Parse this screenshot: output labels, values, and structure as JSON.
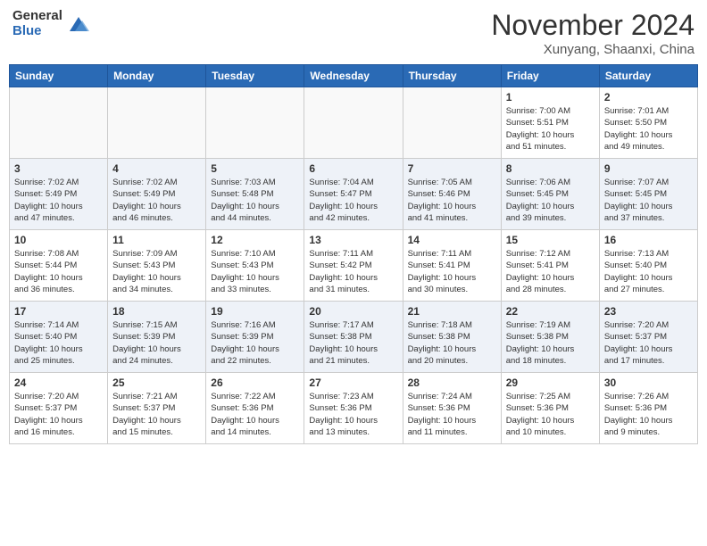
{
  "header": {
    "logo_general": "General",
    "logo_blue": "Blue",
    "month_title": "November 2024",
    "location": "Xunyang, Shaanxi, China"
  },
  "days_of_week": [
    "Sunday",
    "Monday",
    "Tuesday",
    "Wednesday",
    "Thursday",
    "Friday",
    "Saturday"
  ],
  "weeks": [
    [
      {
        "day": "",
        "info": ""
      },
      {
        "day": "",
        "info": ""
      },
      {
        "day": "",
        "info": ""
      },
      {
        "day": "",
        "info": ""
      },
      {
        "day": "",
        "info": ""
      },
      {
        "day": "1",
        "info": "Sunrise: 7:00 AM\nSunset: 5:51 PM\nDaylight: 10 hours\nand 51 minutes."
      },
      {
        "day": "2",
        "info": "Sunrise: 7:01 AM\nSunset: 5:50 PM\nDaylight: 10 hours\nand 49 minutes."
      }
    ],
    [
      {
        "day": "3",
        "info": "Sunrise: 7:02 AM\nSunset: 5:49 PM\nDaylight: 10 hours\nand 47 minutes."
      },
      {
        "day": "4",
        "info": "Sunrise: 7:02 AM\nSunset: 5:49 PM\nDaylight: 10 hours\nand 46 minutes."
      },
      {
        "day": "5",
        "info": "Sunrise: 7:03 AM\nSunset: 5:48 PM\nDaylight: 10 hours\nand 44 minutes."
      },
      {
        "day": "6",
        "info": "Sunrise: 7:04 AM\nSunset: 5:47 PM\nDaylight: 10 hours\nand 42 minutes."
      },
      {
        "day": "7",
        "info": "Sunrise: 7:05 AM\nSunset: 5:46 PM\nDaylight: 10 hours\nand 41 minutes."
      },
      {
        "day": "8",
        "info": "Sunrise: 7:06 AM\nSunset: 5:45 PM\nDaylight: 10 hours\nand 39 minutes."
      },
      {
        "day": "9",
        "info": "Sunrise: 7:07 AM\nSunset: 5:45 PM\nDaylight: 10 hours\nand 37 minutes."
      }
    ],
    [
      {
        "day": "10",
        "info": "Sunrise: 7:08 AM\nSunset: 5:44 PM\nDaylight: 10 hours\nand 36 minutes."
      },
      {
        "day": "11",
        "info": "Sunrise: 7:09 AM\nSunset: 5:43 PM\nDaylight: 10 hours\nand 34 minutes."
      },
      {
        "day": "12",
        "info": "Sunrise: 7:10 AM\nSunset: 5:43 PM\nDaylight: 10 hours\nand 33 minutes."
      },
      {
        "day": "13",
        "info": "Sunrise: 7:11 AM\nSunset: 5:42 PM\nDaylight: 10 hours\nand 31 minutes."
      },
      {
        "day": "14",
        "info": "Sunrise: 7:11 AM\nSunset: 5:41 PM\nDaylight: 10 hours\nand 30 minutes."
      },
      {
        "day": "15",
        "info": "Sunrise: 7:12 AM\nSunset: 5:41 PM\nDaylight: 10 hours\nand 28 minutes."
      },
      {
        "day": "16",
        "info": "Sunrise: 7:13 AM\nSunset: 5:40 PM\nDaylight: 10 hours\nand 27 minutes."
      }
    ],
    [
      {
        "day": "17",
        "info": "Sunrise: 7:14 AM\nSunset: 5:40 PM\nDaylight: 10 hours\nand 25 minutes."
      },
      {
        "day": "18",
        "info": "Sunrise: 7:15 AM\nSunset: 5:39 PM\nDaylight: 10 hours\nand 24 minutes."
      },
      {
        "day": "19",
        "info": "Sunrise: 7:16 AM\nSunset: 5:39 PM\nDaylight: 10 hours\nand 22 minutes."
      },
      {
        "day": "20",
        "info": "Sunrise: 7:17 AM\nSunset: 5:38 PM\nDaylight: 10 hours\nand 21 minutes."
      },
      {
        "day": "21",
        "info": "Sunrise: 7:18 AM\nSunset: 5:38 PM\nDaylight: 10 hours\nand 20 minutes."
      },
      {
        "day": "22",
        "info": "Sunrise: 7:19 AM\nSunset: 5:38 PM\nDaylight: 10 hours\nand 18 minutes."
      },
      {
        "day": "23",
        "info": "Sunrise: 7:20 AM\nSunset: 5:37 PM\nDaylight: 10 hours\nand 17 minutes."
      }
    ],
    [
      {
        "day": "24",
        "info": "Sunrise: 7:20 AM\nSunset: 5:37 PM\nDaylight: 10 hours\nand 16 minutes."
      },
      {
        "day": "25",
        "info": "Sunrise: 7:21 AM\nSunset: 5:37 PM\nDaylight: 10 hours\nand 15 minutes."
      },
      {
        "day": "26",
        "info": "Sunrise: 7:22 AM\nSunset: 5:36 PM\nDaylight: 10 hours\nand 14 minutes."
      },
      {
        "day": "27",
        "info": "Sunrise: 7:23 AM\nSunset: 5:36 PM\nDaylight: 10 hours\nand 13 minutes."
      },
      {
        "day": "28",
        "info": "Sunrise: 7:24 AM\nSunset: 5:36 PM\nDaylight: 10 hours\nand 11 minutes."
      },
      {
        "day": "29",
        "info": "Sunrise: 7:25 AM\nSunset: 5:36 PM\nDaylight: 10 hours\nand 10 minutes."
      },
      {
        "day": "30",
        "info": "Sunrise: 7:26 AM\nSunset: 5:36 PM\nDaylight: 10 hours\nand 9 minutes."
      }
    ]
  ]
}
